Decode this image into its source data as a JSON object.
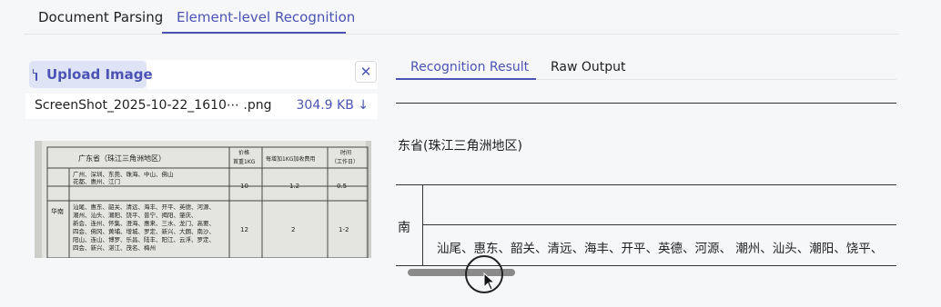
{
  "top_tabs": [
    "Document Parsing",
    "Element-level Recognition"
  ],
  "upload": {
    "button_label": "Upload Image",
    "close_symbol": "✕",
    "file_name": "ScreenShot_2025-10-22_1610⋯ .png",
    "file_size": "304.9 KB ↓"
  },
  "thumbnail": {
    "header_region": "广东省（珠江三角洲地区）",
    "col_price": "价格",
    "col_first_kg": "首重1KG",
    "col_extra": "每增加1KG加收费用",
    "col_time": "时间",
    "col_time_sub": "（工作日）",
    "row_label": "华南",
    "row1_cities_a": "广州、深圳、东莞、珠海、中山、佛山",
    "row1_cities_b": "花都、惠州、江门",
    "row1_first": "10",
    "row1_extra": "1.2",
    "row1_time": "0.5",
    "row2_cities": [
      "汕尾、惠东、韶关、清远、海丰、开平、英德、河源、",
      "潮州、汕头、潮阳、饶平、普宁、揭阳、肇庆、",
      "新会、连州、怀集、澄海、惠来、三水、龙门、高要、",
      "四会、佛冈、黄埔、增城、罗定、新兴、大朗、南沙、",
      "阳山、连山、博罗、乐昌、陆丰、阳江、云浮、罗定、",
      "四会、新兴、湛江、茂名、梅州"
    ],
    "row2_first": "12",
    "row2_extra": "2",
    "row2_time": "1-2"
  },
  "result_tabs": [
    "Recognition Result",
    "Raw Output"
  ],
  "result": {
    "region_text": "东省(珠江三角洲地区)",
    "row_label": "南",
    "cities_text": "汕尾、惠东、韶关、清远、海丰、开平、英德、河源、 潮州、汕头、潮阳、饶平、"
  },
  "colors": {
    "accent": "#4b53b5",
    "accent_bg": "#dfe3f6",
    "background": "#f6f7f9"
  },
  "icons": [
    "file-icon",
    "close-icon",
    "download-icon",
    "mouse-cursor-icon"
  ]
}
